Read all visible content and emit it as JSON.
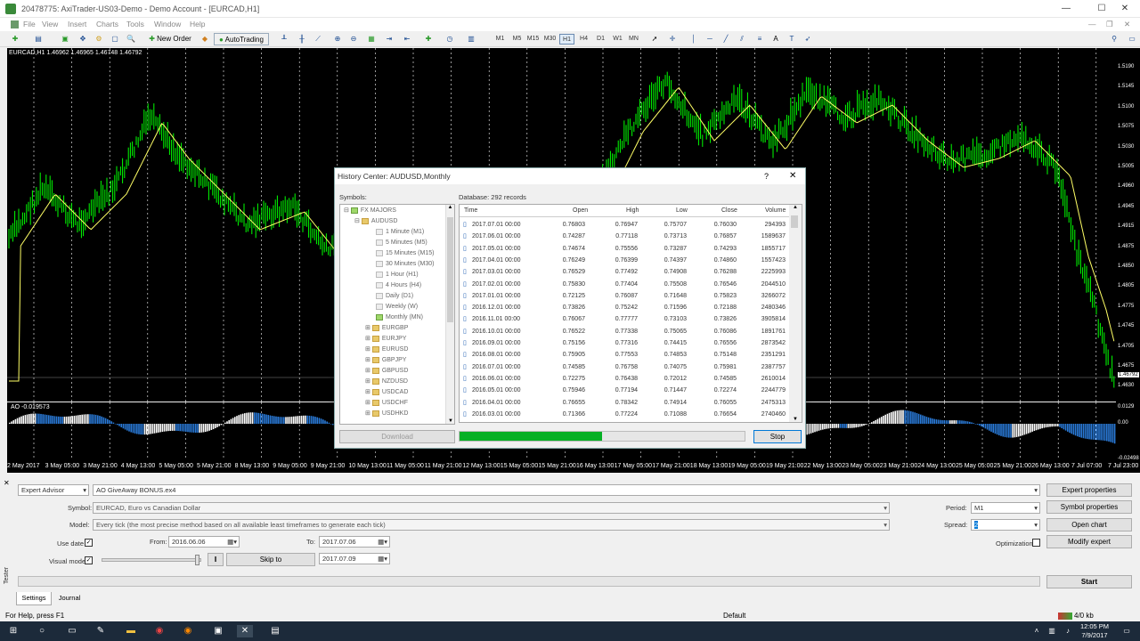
{
  "window": {
    "title": "20478775: AxiTrader-US03-Demo - Demo Account - [EURCAD,H1]"
  },
  "menu": [
    "File",
    "View",
    "Insert",
    "Charts",
    "Tools",
    "Window",
    "Help"
  ],
  "toolbar": {
    "new_order": "New Order",
    "autotrading": "AutoTrading",
    "timeframes": [
      "M1",
      "M5",
      "M15",
      "M30",
      "H1",
      "H4",
      "D1",
      "W1",
      "MN"
    ],
    "active_tf": "H1"
  },
  "chart": {
    "symbol_info": "EURCAD,H1 1.46962 1.46965 1.46748 1.46792",
    "price_labels": [
      "1.5190",
      "1.5145",
      "1.5100",
      "1.5075",
      "1.5030",
      "1.5005",
      "1.4960",
      "1.4945",
      "1.4915",
      "1.4875",
      "1.4850",
      "1.4805",
      "1.4775",
      "1.4745",
      "1.4705",
      "1.4675",
      "1.4630"
    ],
    "current_price": "1.46792",
    "candle_color": "#00ff00",
    "ma_color": "#ffff66",
    "time_labels": [
      "2 May 2017",
      "3 May 05:00",
      "3 May 21:00",
      "4 May 13:00",
      "5 May 05:00",
      "5 May 21:00",
      "8 May 13:00",
      "9 May 05:00",
      "9 May 21:00",
      "10 May 13:00",
      "11 May 05:00",
      "11 May 21:00",
      "12 May 13:00",
      "15 May 05:00",
      "15 May 21:00",
      "16 May 13:00",
      "17 May 05:00",
      "17 May 21:00",
      "18 May 13:00",
      "19 May 05:00",
      "19 May 21:00",
      "22 May 13:00",
      "23 May 05:00",
      "23 May 21:00",
      "24 May 13:00",
      "25 May 05:00",
      "25 May 21:00",
      "26 May 13:00",
      "7 Jul 07:00",
      "7 Jul 23:00"
    ],
    "ao_label": "AO -0.019573",
    "ao_scale": [
      "0.0129",
      "0.00",
      "-0.02498"
    ]
  },
  "dialog": {
    "title": "History Center: AUDUSD,Monthly",
    "help": "?",
    "close": "✕",
    "symbols_label": "Symbols:",
    "database": "Database: 292 records",
    "download": "Download",
    "stop": "Stop",
    "progress": 0.5,
    "tree": {
      "root": "FX MAJORS",
      "selected_symbol": "AUDUSD",
      "periods": [
        "1 Minute (M1)",
        "5 Minutes (M5)",
        "15 Minutes (M15)",
        "30 Minutes (M30)",
        "1 Hour (H1)",
        "4 Hours (H4)",
        "Daily (D1)",
        "Weekly (W)",
        "Monthly (MN)"
      ],
      "symbols": [
        "EURGBP",
        "EURJPY",
        "EURUSD",
        "GBPJPY",
        "GBPUSD",
        "NZDUSD",
        "USDCAD",
        "USDCHF",
        "USDHKD"
      ]
    },
    "columns": [
      "Time",
      "Open",
      "High",
      "Low",
      "Close",
      "Volume"
    ],
    "rows": [
      [
        "2017.07.01 00:00",
        "0.76803",
        "0.76947",
        "0.75707",
        "0.76030",
        "294393"
      ],
      [
        "2017.06.01 00:00",
        "0.74287",
        "0.77118",
        "0.73713",
        "0.76857",
        "1589637"
      ],
      [
        "2017.05.01 00:00",
        "0.74674",
        "0.75556",
        "0.73287",
        "0.74293",
        "1855717"
      ],
      [
        "2017.04.01 00:00",
        "0.76249",
        "0.76399",
        "0.74397",
        "0.74860",
        "1557423"
      ],
      [
        "2017.03.01 00:00",
        "0.76529",
        "0.77492",
        "0.74908",
        "0.76288",
        "2225993"
      ],
      [
        "2017.02.01 00:00",
        "0.75830",
        "0.77404",
        "0.75508",
        "0.76546",
        "2044510"
      ],
      [
        "2017.01.01 00:00",
        "0.72125",
        "0.76087",
        "0.71648",
        "0.75823",
        "3266072"
      ],
      [
        "2016.12.01 00:00",
        "0.73826",
        "0.75242",
        "0.71596",
        "0.72188",
        "2480346"
      ],
      [
        "2016.11.01 00:00",
        "0.76067",
        "0.77777",
        "0.73103",
        "0.73826",
        "3905814"
      ],
      [
        "2016.10.01 00:00",
        "0.76522",
        "0.77338",
        "0.75065",
        "0.76086",
        "1891761"
      ],
      [
        "2016.09.01 00:00",
        "0.75156",
        "0.77316",
        "0.74415",
        "0.76556",
        "2873542"
      ],
      [
        "2016.08.01 00:00",
        "0.75905",
        "0.77553",
        "0.74853",
        "0.75148",
        "2351291"
      ],
      [
        "2016.07.01 00:00",
        "0.74585",
        "0.76758",
        "0.74075",
        "0.75981",
        "2387757"
      ],
      [
        "2016.06.01 00:00",
        "0.72275",
        "0.76438",
        "0.72012",
        "0.74585",
        "2610014"
      ],
      [
        "2016.05.01 00:00",
        "0.75946",
        "0.77194",
        "0.71447",
        "0.72274",
        "2244779"
      ],
      [
        "2016.04.01 00:00",
        "0.76655",
        "0.78342",
        "0.74914",
        "0.76055",
        "2475313"
      ],
      [
        "2016.03.01 00:00",
        "0.71366",
        "0.77224",
        "0.71088",
        "0.76654",
        "2740460"
      ]
    ]
  },
  "tester": {
    "mode": "Expert Advisor",
    "expert": "AO GiveAway BONUS.ex4",
    "symbol_label": "Symbol:",
    "symbol": "EURCAD, Euro vs Canadian Dollar",
    "model_label": "Model:",
    "model": "Every tick (the most precise method based on all available least timeframes to generate each tick)",
    "use_date": "Use date",
    "from_label": "From:",
    "from": "2016.06.06",
    "to_label": "To:",
    "to": "2017.07.06",
    "visual_mode": "Visual mode",
    "skip_to": "Skip to",
    "skip_date": "2017.07.09",
    "period_label": "Period:",
    "period": "M1",
    "spread_label": "Spread:",
    "spread": "2",
    "optimization": "Optimization",
    "expert_properties": "Expert properties",
    "symbol_properties": "Symbol properties",
    "open_chart": "Open chart",
    "modify_expert": "Modify expert",
    "start": "Start",
    "tabs": [
      "Settings",
      "Journal"
    ],
    "side_label": "Tester"
  },
  "status": {
    "help": "For Help, press F1",
    "profile": "Default",
    "traffic": "4/0 kb"
  },
  "taskbar": {
    "time": "12:05 PM",
    "date": "7/9/2017"
  }
}
